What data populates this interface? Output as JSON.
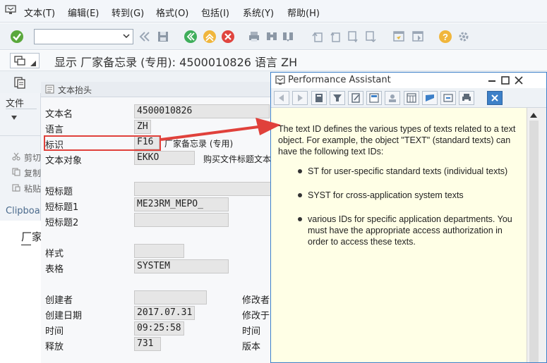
{
  "menubar": {
    "items": [
      "文本(T)",
      "编辑(E)",
      "转到(G)",
      "格式(O)",
      "包括(I)",
      "系统(Y)",
      "帮助(H)"
    ]
  },
  "toolbar": {
    "command_field_value": "",
    "icons": [
      "enter-icon",
      "back-icon",
      "save-icon",
      "green-back-icon",
      "exit-icon",
      "cancel-icon",
      "print-icon",
      "find-icon",
      "find-next-icon",
      "first-page-icon",
      "previous-page-icon",
      "next-page-icon",
      "last-page-icon",
      "new-session-icon",
      "shortcut-icon",
      "help-icon",
      "settings-icon"
    ]
  },
  "title": {
    "text": "显示 厂家备忘录 (专用): 4500010826 语言 ZH"
  },
  "left_panel": {
    "files_label": "文件",
    "cut_label": "剪切",
    "copy_label": "复制",
    "paste_label": "粘贴",
    "clipboard_label": "Clipboar",
    "editor_text": "厂家"
  },
  "form": {
    "section_label": "文本抬头",
    "fields": {
      "text_name_label": "文本名",
      "text_name_value": "4500010826",
      "language_label": "语言",
      "language_value": "ZH",
      "id_label": "标识",
      "id_value": "F16",
      "id_desc": "厂家备忘录 (专用)",
      "text_object_label": "文本对象",
      "text_object_value": "EKKO",
      "text_object_desc": "购买文件标题文本",
      "short_title_label": "短标题",
      "short_title1_label": "短标题1",
      "short_title1_value": "ME23RM_MEPO_",
      "short_title2_label": "短标题2",
      "style_label": "样式",
      "format_label": "表格",
      "format_value": "SYSTEM",
      "created_by_label": "创建者",
      "created_date_label": "创建日期",
      "created_date_value": "2017.07.31",
      "time_label": "时间",
      "time_value": "09:25:58",
      "release_label": "释放",
      "release_value": "731",
      "changed_by_label": "修改者",
      "changed_on_label": "修改于",
      "changed_time_label": "时间",
      "version_label": "版本"
    }
  },
  "performance_assistant": {
    "title": "Performance Assistant",
    "intro": "The text ID defines the various types of texts related to a text object. For example, the object \"TEXT\" (standard texts) can have the following text IDs:",
    "bullets": [
      "ST for user-specific standard texts (individual texts)",
      "SYST for cross-application system texts",
      "various IDs for specific application departments. You must have the appropriate access authorization in order to access these texts."
    ]
  },
  "colors": {
    "highlight": "#e0413b",
    "pa_border": "#3d80c8",
    "pa_background": "#ffffe6"
  }
}
